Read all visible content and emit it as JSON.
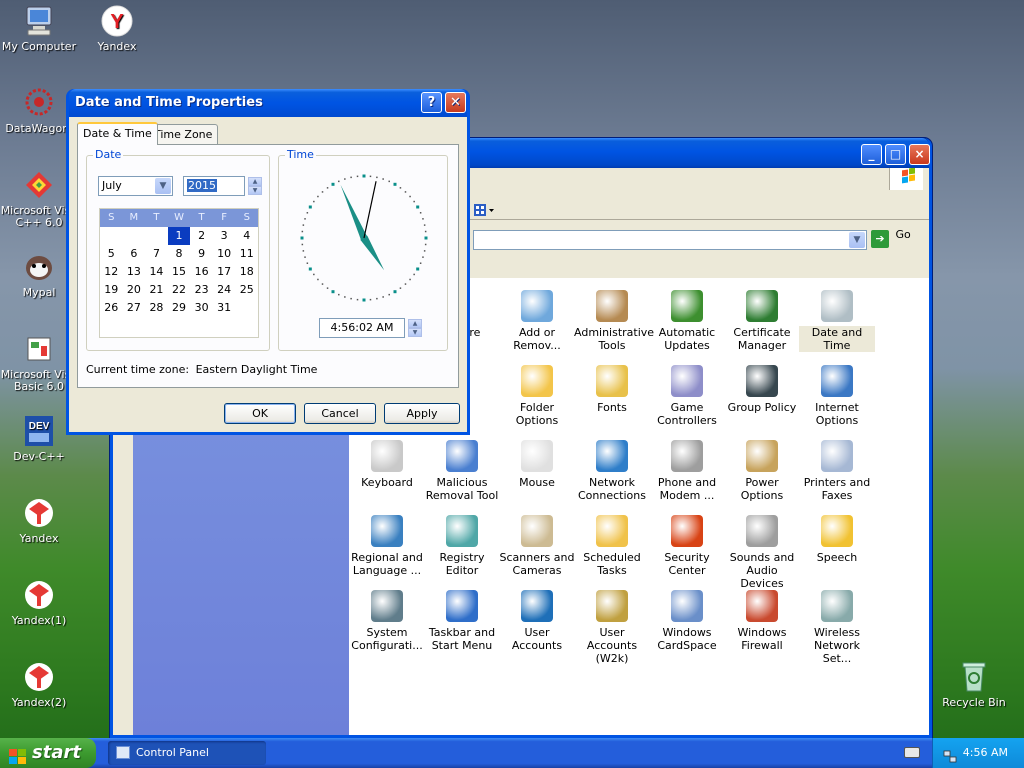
{
  "desktop": {
    "icons": [
      {
        "label": "My Computer"
      },
      {
        "label": "Yandex"
      },
      {
        "label": "DataWagon."
      },
      {
        "label": "Microsoft Visu C++ 6.0"
      },
      {
        "label": "Mypal"
      },
      {
        "label": "Microsoft Visu Basic 6.0"
      },
      {
        "label": "Dev-C++"
      },
      {
        "label": "Yandex"
      },
      {
        "label": "Yandex(1)"
      },
      {
        "label": "Yandex(2)"
      },
      {
        "label": "Recycle Bin"
      }
    ]
  },
  "control_panel": {
    "go_label": "Go",
    "items": [
      {
        "label": "ware"
      },
      {
        "label": "Add or Remov..."
      },
      {
        "label": "Administrative Tools"
      },
      {
        "label": "Automatic Updates"
      },
      {
        "label": "Certificate Manager"
      },
      {
        "label": "Date and Time"
      },
      {
        "label": "y"
      },
      {
        "label": "Folder Options"
      },
      {
        "label": "Fonts"
      },
      {
        "label": "Game Controllers"
      },
      {
        "label": "Group Policy"
      },
      {
        "label": "Internet Options"
      },
      {
        "label": "Keyboard"
      },
      {
        "label": "Malicious Removal Tool"
      },
      {
        "label": "Mouse"
      },
      {
        "label": "Network Connections"
      },
      {
        "label": "Phone and Modem ..."
      },
      {
        "label": "Power Options"
      },
      {
        "label": "Printers and Faxes"
      },
      {
        "label": "Regional and Language ..."
      },
      {
        "label": "Registry Editor"
      },
      {
        "label": "Scanners and Cameras"
      },
      {
        "label": "Scheduled Tasks"
      },
      {
        "label": "Security Center"
      },
      {
        "label": "Sounds and Audio Devices"
      },
      {
        "label": "Speech"
      },
      {
        "label": "System Configurati..."
      },
      {
        "label": "Taskbar and Start Menu"
      },
      {
        "label": "User Accounts"
      },
      {
        "label": "User Accounts (W2k)"
      },
      {
        "label": "Windows CardSpace"
      },
      {
        "label": "Windows Firewall"
      },
      {
        "label": "Wireless Network Set..."
      }
    ]
  },
  "dialog": {
    "title": "Date and Time Properties",
    "help_label": "?",
    "tabs": [
      {
        "label": "Date & Time"
      },
      {
        "label": "Time Zone"
      }
    ],
    "date_group_label": "Date",
    "month": "July",
    "year": "2015",
    "weekdays": [
      "S",
      "M",
      "T",
      "W",
      "T",
      "F",
      "S"
    ],
    "calendar_rows": [
      [
        "",
        "",
        "",
        "1",
        "2",
        "3",
        "4"
      ],
      [
        "5",
        "6",
        "7",
        "8",
        "9",
        "10",
        "11"
      ],
      [
        "12",
        "13",
        "14",
        "15",
        "16",
        "17",
        "18"
      ],
      [
        "19",
        "20",
        "21",
        "22",
        "23",
        "24",
        "25"
      ],
      [
        "26",
        "27",
        "28",
        "29",
        "30",
        "31",
        ""
      ]
    ],
    "selected_day": "1",
    "time_group_label": "Time",
    "time_value": "4:56:02 AM",
    "clock": {
      "hour": 4,
      "minute": 56,
      "second": 2
    },
    "current_tz_label": "Current time zone:",
    "current_tz_value": "Eastern Daylight Time",
    "ok_label": "OK",
    "cancel_label": "Cancel",
    "apply_label": "Apply"
  },
  "taskbar": {
    "start_label": "start",
    "task_label": "Control Panel",
    "clock": "4:56 AM"
  }
}
